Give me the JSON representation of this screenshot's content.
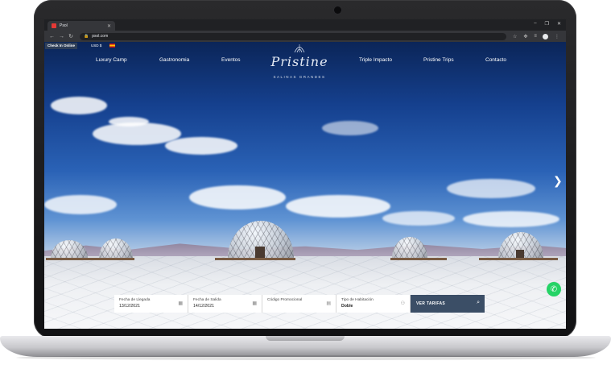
{
  "browser": {
    "tab_title": "Psol",
    "url": "psol.com",
    "colors": {
      "tabbar": "#202124",
      "toolbar": "#35363a"
    }
  },
  "topbar": {
    "check_in": "Check In Online",
    "currency": "USD $"
  },
  "nav": {
    "left": [
      "Luxury Camp",
      "Gastronomia",
      "Eventos"
    ],
    "right": [
      "Triple Impacto",
      "Pristine Trips",
      "Contacto"
    ]
  },
  "logo": {
    "name": "Pristine",
    "tagline": "SALINAS GRANDES"
  },
  "booking": {
    "arrival_label": "Fecha de Llegada",
    "arrival_value": "13/12/2021",
    "departure_label": "Fecha de Salida",
    "departure_value": "14/12/2021",
    "promo_label": "Código Promocional",
    "room_label": "Tipo de Habitación",
    "room_value": "Doble",
    "search_button": "VER TARIFAS"
  },
  "icons": [
    "calendar-icon",
    "ticket-icon",
    "people-icon",
    "search-icon",
    "whatsapp-icon",
    "chevron-right-icon"
  ],
  "accent_color": "#3b4e66"
}
